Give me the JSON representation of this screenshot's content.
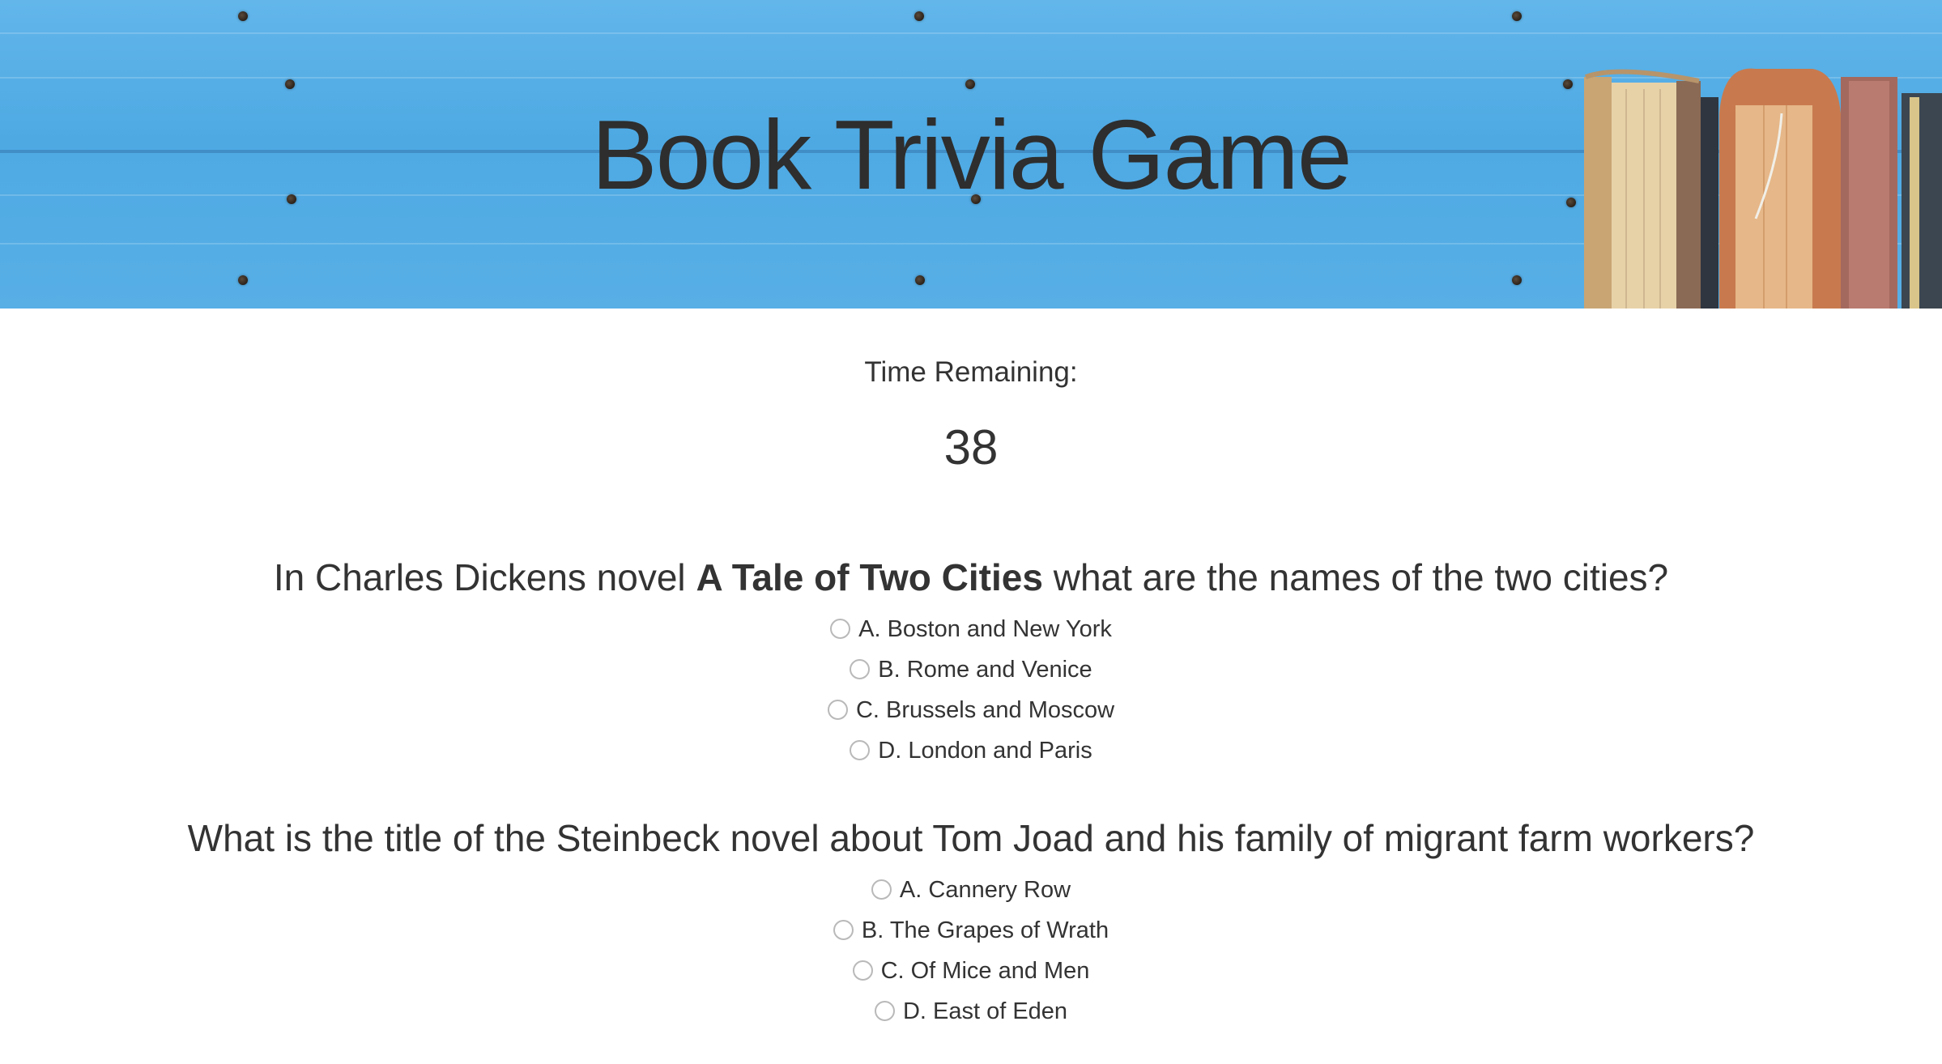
{
  "header": {
    "title": "Book Trivia Game"
  },
  "timer": {
    "label": "Time Remaining:",
    "value": "38"
  },
  "questions": [
    {
      "text_before": "In Charles Dickens novel ",
      "text_bold": "A Tale of Two Cities",
      "text_after": " what are the names of the two cities?",
      "options": [
        "A. Boston and New York",
        "B. Rome and Venice",
        "C. Brussels and Moscow",
        "D. London and Paris"
      ]
    },
    {
      "text": "What is the title of the Steinbeck novel about Tom Joad and his family of migrant farm workers?",
      "options": [
        "A. Cannery Row",
        "B. The Grapes of Wrath",
        "C. Of Mice and Men",
        "D. East of Eden"
      ]
    }
  ],
  "colors": {
    "banner_blue": "#58afe6",
    "text": "#333333",
    "radio_border": "#b9b9b9"
  }
}
